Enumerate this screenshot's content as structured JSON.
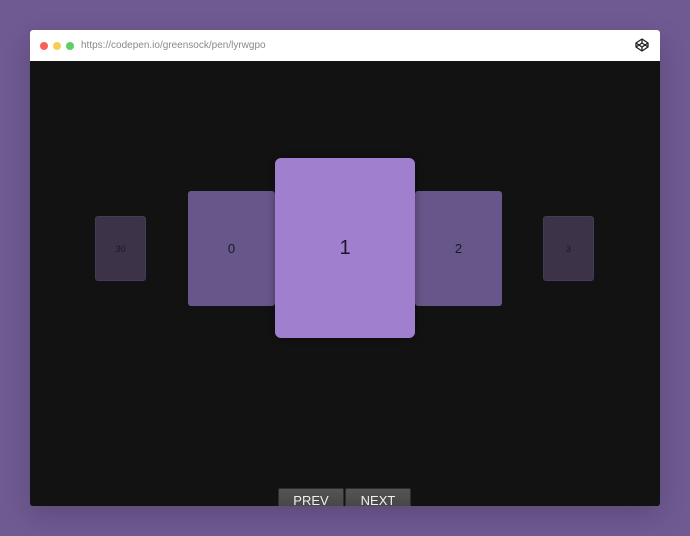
{
  "browser": {
    "url": "https://codepen.io/greensock/pen/lyrwgpo",
    "icon": "codepen-icon"
  },
  "carousel": {
    "cards": [
      {
        "label": "30",
        "position": "far-left"
      },
      {
        "label": "0",
        "position": "near-left"
      },
      {
        "label": "1",
        "position": "center"
      },
      {
        "label": "2",
        "position": "near-right"
      },
      {
        "label": "3",
        "position": "far-right"
      }
    ],
    "colors": {
      "center": "#a07fcf",
      "near": "#67568a",
      "far": "#3d3349"
    }
  },
  "controls": {
    "prev_label": "PREV",
    "next_label": "NEXT"
  }
}
